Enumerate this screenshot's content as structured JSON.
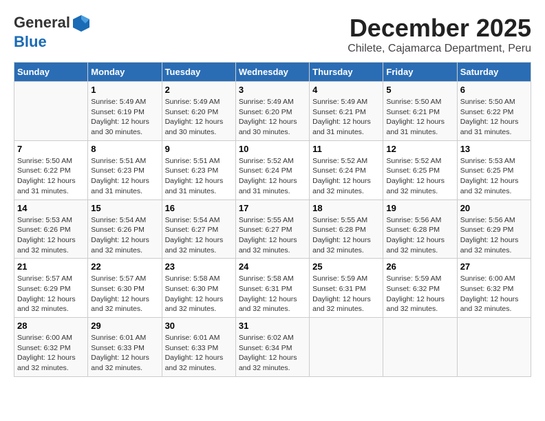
{
  "header": {
    "logo_line1": "General",
    "logo_line2": "Blue",
    "month": "December 2025",
    "location": "Chilete, Cajamarca Department, Peru"
  },
  "days_of_week": [
    "Sunday",
    "Monday",
    "Tuesday",
    "Wednesday",
    "Thursday",
    "Friday",
    "Saturday"
  ],
  "weeks": [
    [
      {
        "day": "",
        "sunrise": "",
        "sunset": "",
        "daylight": ""
      },
      {
        "day": "1",
        "sunrise": "Sunrise: 5:49 AM",
        "sunset": "Sunset: 6:19 PM",
        "daylight": "Daylight: 12 hours and 30 minutes."
      },
      {
        "day": "2",
        "sunrise": "Sunrise: 5:49 AM",
        "sunset": "Sunset: 6:20 PM",
        "daylight": "Daylight: 12 hours and 30 minutes."
      },
      {
        "day": "3",
        "sunrise": "Sunrise: 5:49 AM",
        "sunset": "Sunset: 6:20 PM",
        "daylight": "Daylight: 12 hours and 30 minutes."
      },
      {
        "day": "4",
        "sunrise": "Sunrise: 5:49 AM",
        "sunset": "Sunset: 6:21 PM",
        "daylight": "Daylight: 12 hours and 31 minutes."
      },
      {
        "day": "5",
        "sunrise": "Sunrise: 5:50 AM",
        "sunset": "Sunset: 6:21 PM",
        "daylight": "Daylight: 12 hours and 31 minutes."
      },
      {
        "day": "6",
        "sunrise": "Sunrise: 5:50 AM",
        "sunset": "Sunset: 6:22 PM",
        "daylight": "Daylight: 12 hours and 31 minutes."
      }
    ],
    [
      {
        "day": "7",
        "sunrise": "Sunrise: 5:50 AM",
        "sunset": "Sunset: 6:22 PM",
        "daylight": "Daylight: 12 hours and 31 minutes."
      },
      {
        "day": "8",
        "sunrise": "Sunrise: 5:51 AM",
        "sunset": "Sunset: 6:23 PM",
        "daylight": "Daylight: 12 hours and 31 minutes."
      },
      {
        "day": "9",
        "sunrise": "Sunrise: 5:51 AM",
        "sunset": "Sunset: 6:23 PM",
        "daylight": "Daylight: 12 hours and 31 minutes."
      },
      {
        "day": "10",
        "sunrise": "Sunrise: 5:52 AM",
        "sunset": "Sunset: 6:24 PM",
        "daylight": "Daylight: 12 hours and 31 minutes."
      },
      {
        "day": "11",
        "sunrise": "Sunrise: 5:52 AM",
        "sunset": "Sunset: 6:24 PM",
        "daylight": "Daylight: 12 hours and 32 minutes."
      },
      {
        "day": "12",
        "sunrise": "Sunrise: 5:52 AM",
        "sunset": "Sunset: 6:25 PM",
        "daylight": "Daylight: 12 hours and 32 minutes."
      },
      {
        "day": "13",
        "sunrise": "Sunrise: 5:53 AM",
        "sunset": "Sunset: 6:25 PM",
        "daylight": "Daylight: 12 hours and 32 minutes."
      }
    ],
    [
      {
        "day": "14",
        "sunrise": "Sunrise: 5:53 AM",
        "sunset": "Sunset: 6:26 PM",
        "daylight": "Daylight: 12 hours and 32 minutes."
      },
      {
        "day": "15",
        "sunrise": "Sunrise: 5:54 AM",
        "sunset": "Sunset: 6:26 PM",
        "daylight": "Daylight: 12 hours and 32 minutes."
      },
      {
        "day": "16",
        "sunrise": "Sunrise: 5:54 AM",
        "sunset": "Sunset: 6:27 PM",
        "daylight": "Daylight: 12 hours and 32 minutes."
      },
      {
        "day": "17",
        "sunrise": "Sunrise: 5:55 AM",
        "sunset": "Sunset: 6:27 PM",
        "daylight": "Daylight: 12 hours and 32 minutes."
      },
      {
        "day": "18",
        "sunrise": "Sunrise: 5:55 AM",
        "sunset": "Sunset: 6:28 PM",
        "daylight": "Daylight: 12 hours and 32 minutes."
      },
      {
        "day": "19",
        "sunrise": "Sunrise: 5:56 AM",
        "sunset": "Sunset: 6:28 PM",
        "daylight": "Daylight: 12 hours and 32 minutes."
      },
      {
        "day": "20",
        "sunrise": "Sunrise: 5:56 AM",
        "sunset": "Sunset: 6:29 PM",
        "daylight": "Daylight: 12 hours and 32 minutes."
      }
    ],
    [
      {
        "day": "21",
        "sunrise": "Sunrise: 5:57 AM",
        "sunset": "Sunset: 6:29 PM",
        "daylight": "Daylight: 12 hours and 32 minutes."
      },
      {
        "day": "22",
        "sunrise": "Sunrise: 5:57 AM",
        "sunset": "Sunset: 6:30 PM",
        "daylight": "Daylight: 12 hours and 32 minutes."
      },
      {
        "day": "23",
        "sunrise": "Sunrise: 5:58 AM",
        "sunset": "Sunset: 6:30 PM",
        "daylight": "Daylight: 12 hours and 32 minutes."
      },
      {
        "day": "24",
        "sunrise": "Sunrise: 5:58 AM",
        "sunset": "Sunset: 6:31 PM",
        "daylight": "Daylight: 12 hours and 32 minutes."
      },
      {
        "day": "25",
        "sunrise": "Sunrise: 5:59 AM",
        "sunset": "Sunset: 6:31 PM",
        "daylight": "Daylight: 12 hours and 32 minutes."
      },
      {
        "day": "26",
        "sunrise": "Sunrise: 5:59 AM",
        "sunset": "Sunset: 6:32 PM",
        "daylight": "Daylight: 12 hours and 32 minutes."
      },
      {
        "day": "27",
        "sunrise": "Sunrise: 6:00 AM",
        "sunset": "Sunset: 6:32 PM",
        "daylight": "Daylight: 12 hours and 32 minutes."
      }
    ],
    [
      {
        "day": "28",
        "sunrise": "Sunrise: 6:00 AM",
        "sunset": "Sunset: 6:32 PM",
        "daylight": "Daylight: 12 hours and 32 minutes."
      },
      {
        "day": "29",
        "sunrise": "Sunrise: 6:01 AM",
        "sunset": "Sunset: 6:33 PM",
        "daylight": "Daylight: 12 hours and 32 minutes."
      },
      {
        "day": "30",
        "sunrise": "Sunrise: 6:01 AM",
        "sunset": "Sunset: 6:33 PM",
        "daylight": "Daylight: 12 hours and 32 minutes."
      },
      {
        "day": "31",
        "sunrise": "Sunrise: 6:02 AM",
        "sunset": "Sunset: 6:34 PM",
        "daylight": "Daylight: 12 hours and 32 minutes."
      },
      {
        "day": "",
        "sunrise": "",
        "sunset": "",
        "daylight": ""
      },
      {
        "day": "",
        "sunrise": "",
        "sunset": "",
        "daylight": ""
      },
      {
        "day": "",
        "sunrise": "",
        "sunset": "",
        "daylight": ""
      }
    ]
  ]
}
